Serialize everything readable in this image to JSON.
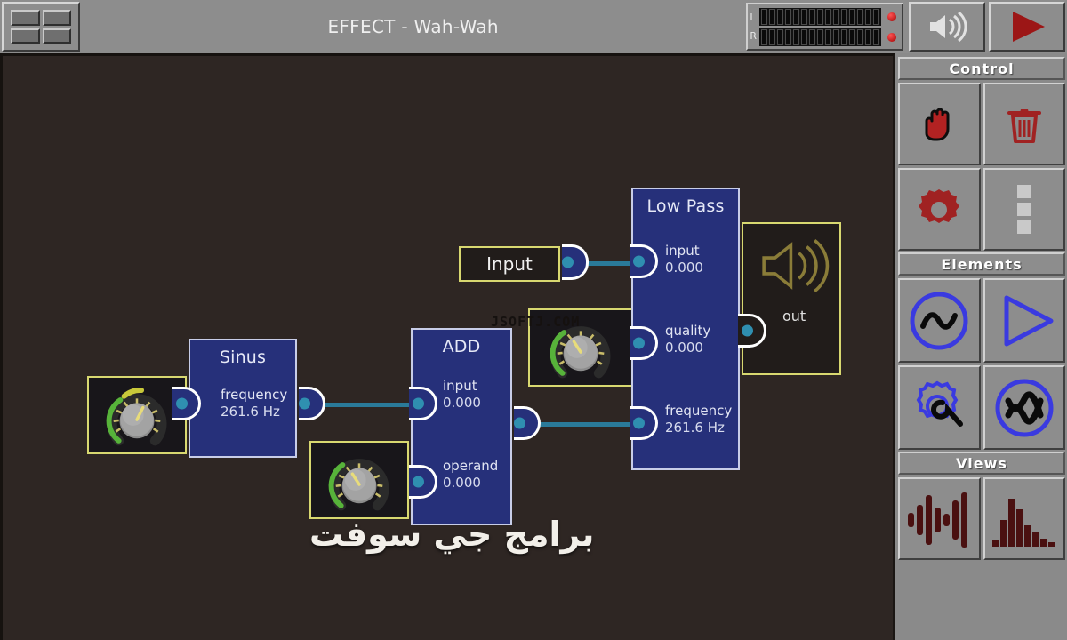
{
  "window": {
    "title": "EFFECT - Wah-Wah",
    "grid_button": "grid-view-button"
  },
  "meter": {
    "left_label": "L",
    "right_label": "R",
    "segments": 15,
    "clip_color": "#cc2222"
  },
  "transport": {
    "volume_label": "speaker-icon",
    "play_label": "play-icon"
  },
  "canvas": {
    "background": "#2e2623",
    "wire_color": "#2a7a99",
    "watermark_mono": "JSOFTJ.COM",
    "watermark_arabic": "برامج جي سوفت"
  },
  "nodes": [
    {
      "id": "input",
      "type": "io",
      "title": "Input",
      "ports": [
        {
          "name": "out",
          "kind": "output"
        }
      ]
    },
    {
      "id": "sinus",
      "type": "module",
      "title": "Sinus",
      "ports": [
        {
          "name": "frequency",
          "value": "261.6 Hz",
          "kind": "input"
        },
        {
          "name": "",
          "value": "",
          "kind": "output"
        }
      ]
    },
    {
      "id": "add",
      "type": "module",
      "title": "ADD",
      "ports": [
        {
          "name": "input",
          "value": "0.000",
          "kind": "input"
        },
        {
          "name": "operand",
          "value": "0.000",
          "kind": "input"
        },
        {
          "name": "",
          "value": "",
          "kind": "output"
        }
      ]
    },
    {
      "id": "lowpass",
      "type": "module",
      "title": "Low Pass",
      "ports": [
        {
          "name": "input",
          "value": "0.000",
          "kind": "input"
        },
        {
          "name": "quality",
          "value": "0.000",
          "kind": "input"
        },
        {
          "name": "frequency",
          "value": "261.6 Hz",
          "kind": "input"
        }
      ]
    },
    {
      "id": "output",
      "type": "io",
      "title": "out",
      "ports": [
        {
          "name": "out",
          "kind": "input"
        }
      ]
    }
  ],
  "labels": {
    "input_title": "Input",
    "sinus_title": "Sinus",
    "sinus_freq_name": "frequency",
    "sinus_freq_value": "261.6 Hz",
    "add_title": "ADD",
    "add_input_name": "input",
    "add_input_value": "0.000",
    "add_operand_name": "operand",
    "add_operand_value": "0.000",
    "lowpass_title": "Low Pass",
    "lp_input_name": "input",
    "lp_input_value": "0.000",
    "lp_quality_name": "quality",
    "lp_quality_value": "0.000",
    "lp_freq_name": "frequency",
    "lp_freq_value": "261.6 Hz",
    "out_title": "out"
  },
  "sidebar": {
    "sections": [
      {
        "title": "Control",
        "tiles": [
          {
            "icon": "hand-cursor-icon",
            "label": "Select / Move"
          },
          {
            "icon": "trash-icon",
            "label": "Delete"
          },
          {
            "icon": "gear-icon",
            "label": "Settings"
          },
          {
            "icon": "dots-menu-icon",
            "label": "More"
          }
        ]
      },
      {
        "title": "Elements",
        "tiles": [
          {
            "icon": "sine-oscillator-icon",
            "label": "Oscillator"
          },
          {
            "icon": "amplifier-triangle-icon",
            "label": "Amplifier"
          },
          {
            "icon": "gear-wrench-icon",
            "label": "Processor"
          },
          {
            "icon": "noise-icon",
            "label": "Noise"
          }
        ]
      },
      {
        "title": "Views",
        "tiles": [
          {
            "icon": "waveform-icon",
            "label": "Waveform"
          },
          {
            "icon": "spectrum-icon",
            "label": "Spectrum"
          }
        ]
      }
    ]
  },
  "colors": {
    "module_fill": "#26307a",
    "module_border": "#c8cde8",
    "io_border": "#d8d870",
    "accent_red": "#a02020",
    "accent_blue": "#3a3ad0",
    "knob_arc_green": "#57b33a"
  }
}
